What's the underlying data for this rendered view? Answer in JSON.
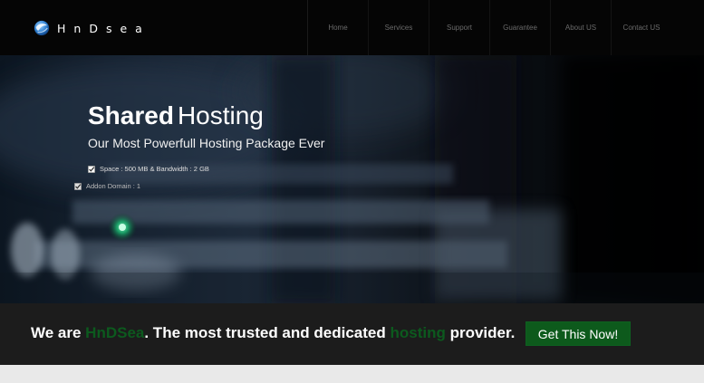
{
  "header": {
    "logo_text": "HnDsea",
    "logo_icon": "globe-swirl-icon",
    "nav": [
      {
        "label": "Home"
      },
      {
        "label": "Services"
      },
      {
        "label": "Support"
      },
      {
        "label": "Guarantee"
      },
      {
        "label": "About US"
      },
      {
        "label": "Contact US"
      }
    ]
  },
  "hero": {
    "title_bold": "Shared",
    "title_light": "Hosting",
    "subtitle": "Our Most Powerfull Hosting Package Ever",
    "features": [
      {
        "text": "Space : 500 MB & Bandwidth : 2 GB",
        "icon": "checkbox-icon"
      },
      {
        "text": "Addon Domain : 1",
        "icon": "checkbox-icon"
      }
    ]
  },
  "cta": {
    "text_prefix": "We are ",
    "brand": "HnDSea",
    "text_middle": ". The most trusted and dedicated ",
    "highlight": "hosting",
    "text_suffix": " provider.",
    "button_label": "Get This Now!"
  },
  "colors": {
    "header_bg": "#050505",
    "cta_bg": "#1c1c1c",
    "accent_green": "#0d5a1c",
    "page_bg": "#e9e9e9"
  }
}
